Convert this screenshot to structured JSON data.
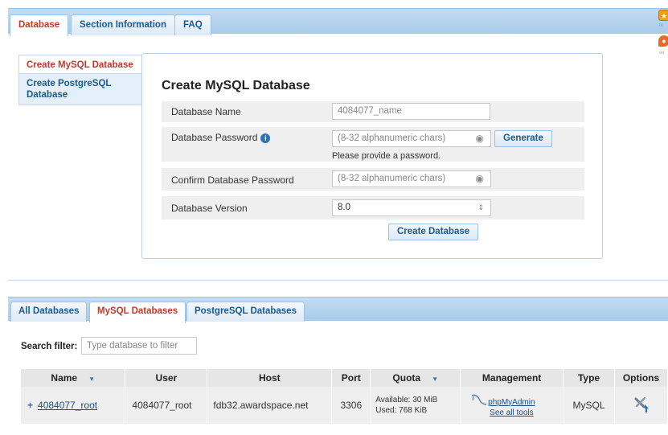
{
  "top_tabs": [
    {
      "label": "Database",
      "active": true
    },
    {
      "label": "Section Information",
      "active": false
    },
    {
      "label": "FAQ",
      "active": false
    }
  ],
  "side_icons": {
    "feedback_label": "fe",
    "support_label": "su"
  },
  "sidenav": [
    {
      "label": "Create MySQL Database",
      "active": true
    },
    {
      "label": "Create PostgreSQL Database",
      "active": false
    }
  ],
  "form": {
    "title": "Create MySQL Database",
    "db_name": {
      "label": "Database Name",
      "value": "4084077_name"
    },
    "db_password": {
      "label": "Database Password",
      "placeholder": "(8-32 alphanumeric chars)",
      "hint": "Please provide a password.",
      "generate_label": "Generate"
    },
    "confirm_password": {
      "label": "Confirm Database Password",
      "placeholder": "(8-32 alphanumeric chars)"
    },
    "db_version": {
      "label": "Database Version",
      "value": "8.0"
    },
    "submit_label": "Create Database"
  },
  "db_tabs": [
    {
      "label": "All Databases",
      "active": false
    },
    {
      "label": "MySQL Databases",
      "active": true
    },
    {
      "label": "PostgreSQL Databases",
      "active": false
    }
  ],
  "filter": {
    "label": "Search filter:",
    "placeholder": "Type database to filter"
  },
  "table": {
    "headers": [
      "Name",
      "User",
      "Host",
      "Port",
      "Quota",
      "Management",
      "Type",
      "Options"
    ],
    "rows": [
      {
        "name": "4084077_root",
        "user": "4084077_root",
        "host": "fdb32.awardspace.net",
        "port": "3306",
        "quota_available": "Available: 30 MiB",
        "quota_used": "Used: 768 KiB",
        "mgmt_link": "phpMyAdmin",
        "mgmt_all": "See all tools",
        "type": "MySQL"
      }
    ]
  },
  "colors": {
    "accent": "#1a5a92",
    "active_tab_text": "#c0392b",
    "tabbar": "#b8d5ee",
    "row_bg": "#efefef"
  }
}
